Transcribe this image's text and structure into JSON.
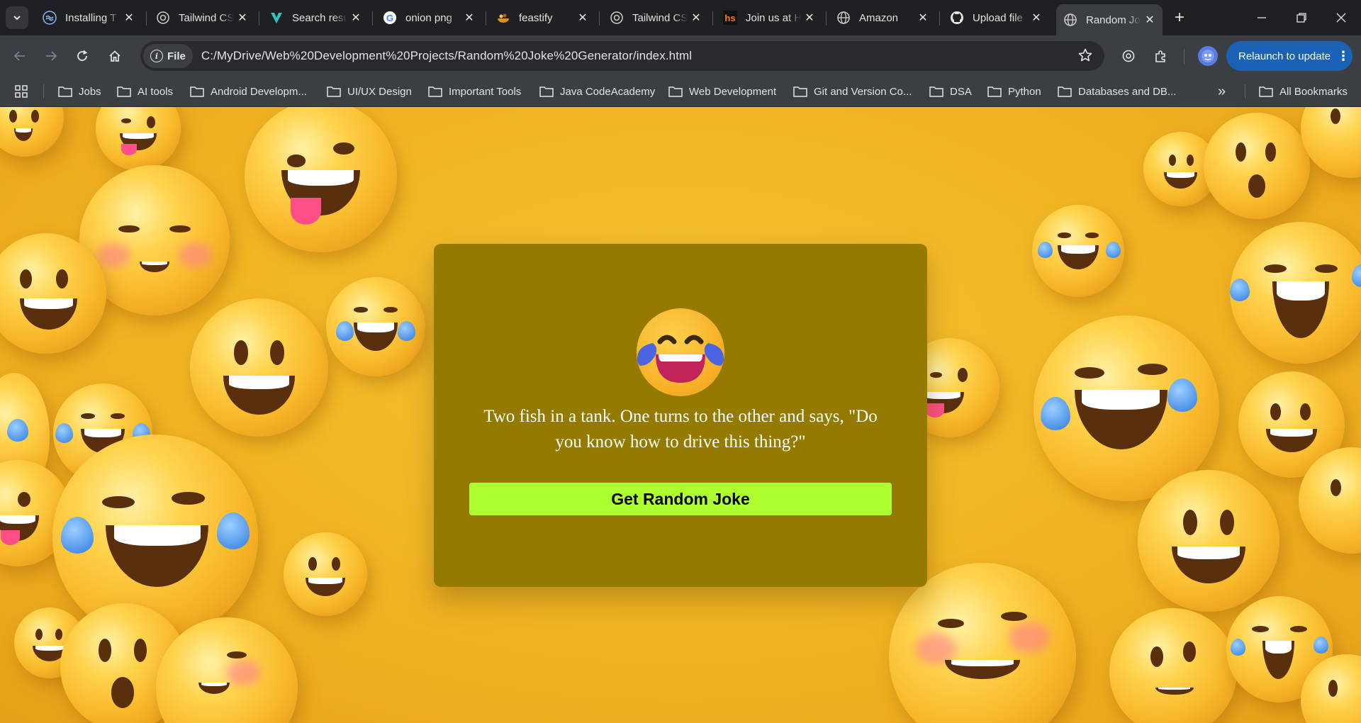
{
  "tabs": [
    {
      "title": "Installing T",
      "icon": "tailwind-icon",
      "active": false
    },
    {
      "title": "Tailwind CS",
      "icon": "openai-icon",
      "active": false
    },
    {
      "title": "Search resu",
      "icon": "vuetify-icon",
      "active": false
    },
    {
      "title": "onion png",
      "icon": "google-icon",
      "active": false
    },
    {
      "title": "feastify",
      "icon": "food-icon",
      "active": false
    },
    {
      "title": "Tailwind CS",
      "icon": "openai-icon",
      "active": false
    },
    {
      "title": "Join us at H",
      "icon": "hackerspace-icon",
      "active": false
    },
    {
      "title": "Amazon",
      "icon": "globe-icon",
      "active": false
    },
    {
      "title": "Upload file",
      "icon": "github-icon",
      "active": false
    },
    {
      "title": "Random Jo",
      "icon": "globe-icon",
      "active": true
    }
  ],
  "toolbar": {
    "chip_label": "File",
    "url": "C:/MyDrive/Web%20Development%20Projects/Random%20Joke%20Generator/index.html",
    "relaunch_label": "Relaunch to update"
  },
  "bookmarks": [
    {
      "label": "Jobs"
    },
    {
      "label": "AI tools"
    },
    {
      "label": "Android Developm..."
    },
    {
      "label": "UI/UX Design"
    },
    {
      "label": "Important Tools"
    },
    {
      "label": "Java CodeAcademy"
    },
    {
      "label": "Web Development"
    },
    {
      "label": "Git and Version Co..."
    },
    {
      "label": "DSA"
    },
    {
      "label": "Python"
    },
    {
      "label": "Databases and DB..."
    }
  ],
  "all_bookmarks_label": "All Bookmarks",
  "page": {
    "joke_text": "Two fish in a tank. One turns to the other and says, \"Do you know how to drive this thing?\"",
    "button_label": "Get Random Joke",
    "card_color": "#947a00",
    "button_color": "#adff2f",
    "background_color": "#f2b724"
  }
}
